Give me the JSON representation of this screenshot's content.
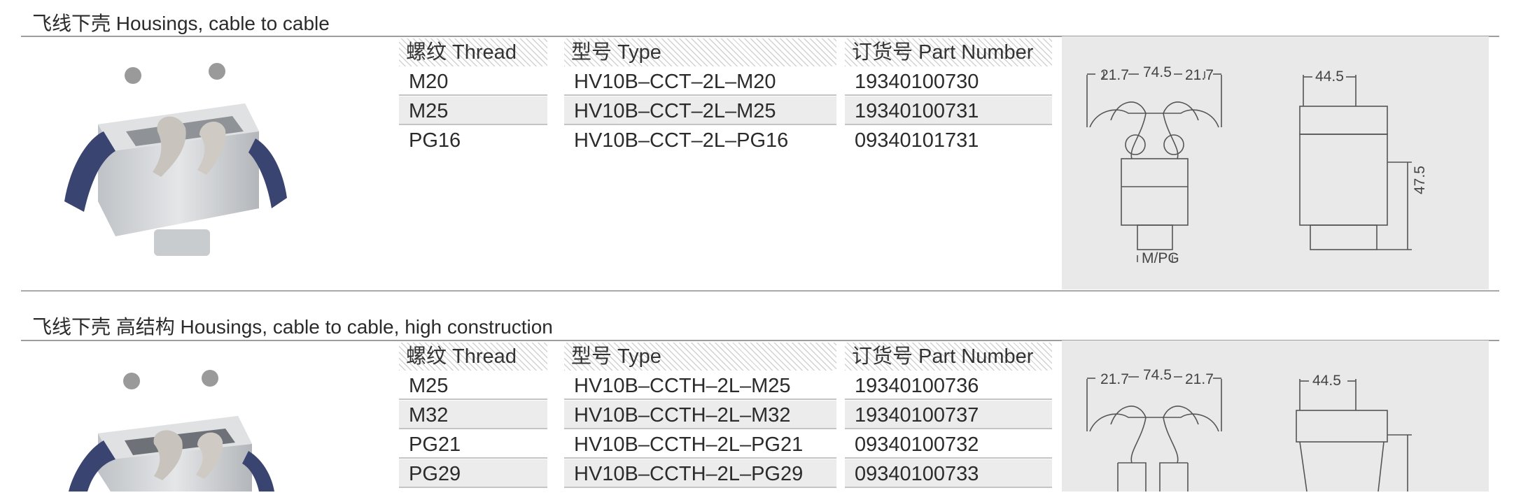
{
  "sections": [
    {
      "title": "飞线下壳 Housings, cable to cable",
      "headers": {
        "thread": "螺纹 Thread",
        "type": "型号 Type",
        "part": "订货号 Part Number"
      },
      "rows": [
        {
          "thread": "M20",
          "type": "HV10B–CCT–2L–M20",
          "part": "19340100730"
        },
        {
          "thread": "M25",
          "type": "HV10B–CCT–2L–M25",
          "part": "19340100731"
        },
        {
          "thread": "PG16",
          "type": "HV10B–CCT–2L–PG16",
          "part": "09340101731"
        }
      ],
      "drawing": {
        "dim_side": "21.7",
        "dim_mid": "74.5",
        "dim_side_right": "21.7",
        "dim_depth": "44.5",
        "dim_height": "47.5",
        "dim_thread": "M/PG"
      }
    },
    {
      "title": "飞线下壳 高结构 Housings, cable to cable, high construction",
      "headers": {
        "thread": "螺纹 Thread",
        "type": "型号 Type",
        "part": "订货号 Part Number"
      },
      "rows": [
        {
          "thread": "M25",
          "type": "HV10B–CCTH–2L–M25",
          "part": "19340100736"
        },
        {
          "thread": "M32",
          "type": "HV10B–CCTH–2L–M32",
          "part": "19340100737"
        },
        {
          "thread": "PG21",
          "type": "HV10B–CCTH–2L–PG21",
          "part": "09340100732"
        },
        {
          "thread": "PG29",
          "type": "HV10B–CCTH–2L–PG29",
          "part": "09340100733"
        }
      ],
      "drawing": {
        "dim_side": "21.7",
        "dim_mid": "74.5",
        "dim_side_right": "21.7",
        "dim_depth": "44.5"
      }
    }
  ]
}
